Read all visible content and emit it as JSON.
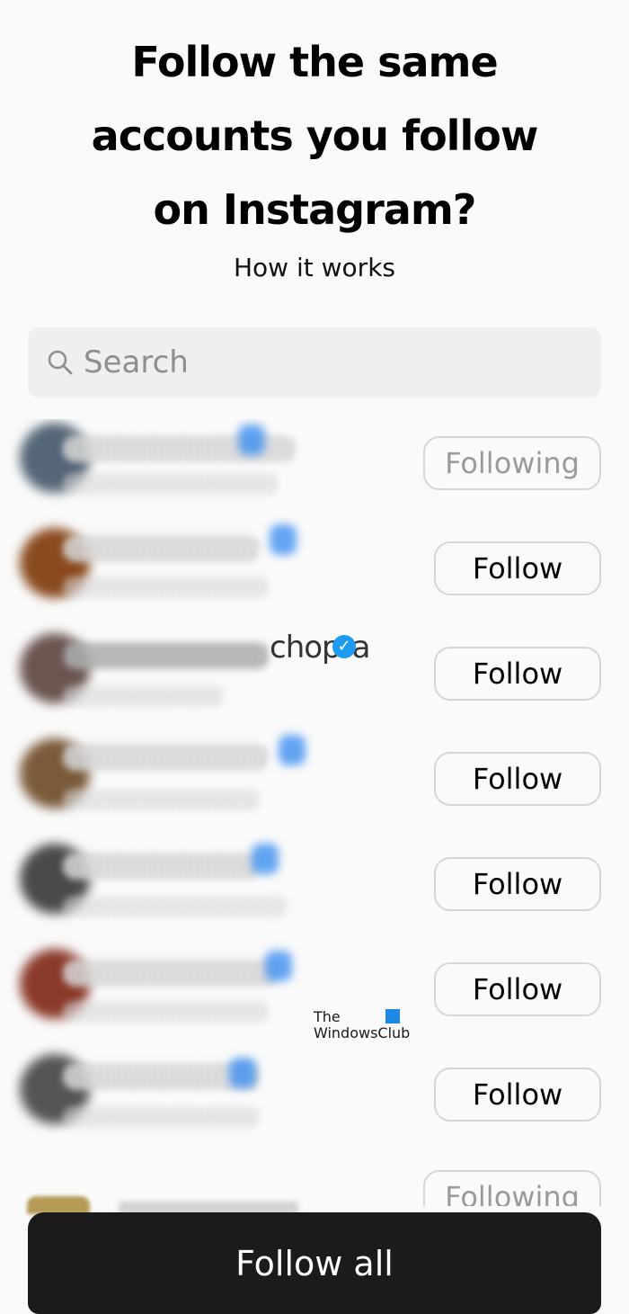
{
  "header": {
    "title_lines": [
      "Follow the same",
      "accounts you follow",
      "on Instagram?"
    ],
    "how_it_works": "How it works"
  },
  "search": {
    "placeholder": "Search",
    "icon": "search-icon"
  },
  "accounts": [
    {
      "name": "",
      "button": "Following",
      "state": "following",
      "avatar_color": "#556677"
    },
    {
      "name": "",
      "button": "Follow",
      "state": "follow",
      "avatar_color": "#8a4a1e"
    },
    {
      "name": "chopra",
      "verified": true,
      "button": "Follow",
      "state": "follow",
      "avatar_color": "#6b5550"
    },
    {
      "name": "",
      "button": "Follow",
      "state": "follow",
      "avatar_color": "#7a5a3a"
    },
    {
      "name": "",
      "button": "Follow",
      "state": "follow",
      "avatar_color": "#4a4a4a"
    },
    {
      "name": "",
      "button": "Follow",
      "state": "follow",
      "avatar_color": "#8a3a2a"
    },
    {
      "name": "",
      "button": "Follow",
      "state": "follow",
      "avatar_color": "#555555"
    },
    {
      "name": "",
      "button": "Following",
      "state": "following",
      "avatar_color": "#b59a55"
    }
  ],
  "watermark": {
    "line1": "The",
    "line2": "WindowsClub"
  },
  "footer": {
    "follow_all": "Follow all"
  },
  "colors": {
    "primary_button": "#1b1b1b",
    "verified": "#1d9bf0"
  }
}
